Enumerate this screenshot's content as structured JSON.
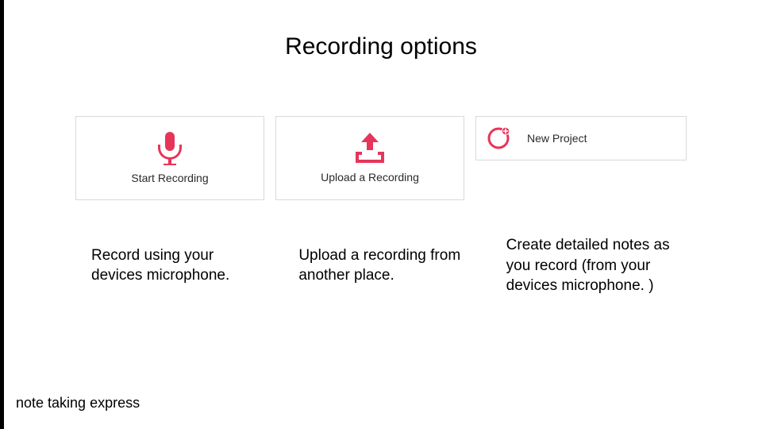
{
  "title": "Recording options",
  "accent": "#e6355a",
  "cards": [
    {
      "label": "Start Recording",
      "icon": "microphone-icon"
    },
    {
      "label": "Upload a Recording",
      "icon": "upload-icon"
    },
    {
      "label": "New Project",
      "icon": "plus-circle-icon"
    }
  ],
  "descriptions": [
    "Record using your devices microphone.",
    "Upload a recording from another place.",
    "Create detailed notes as you record\n(from your devices microphone. )"
  ],
  "footer": "note taking express"
}
